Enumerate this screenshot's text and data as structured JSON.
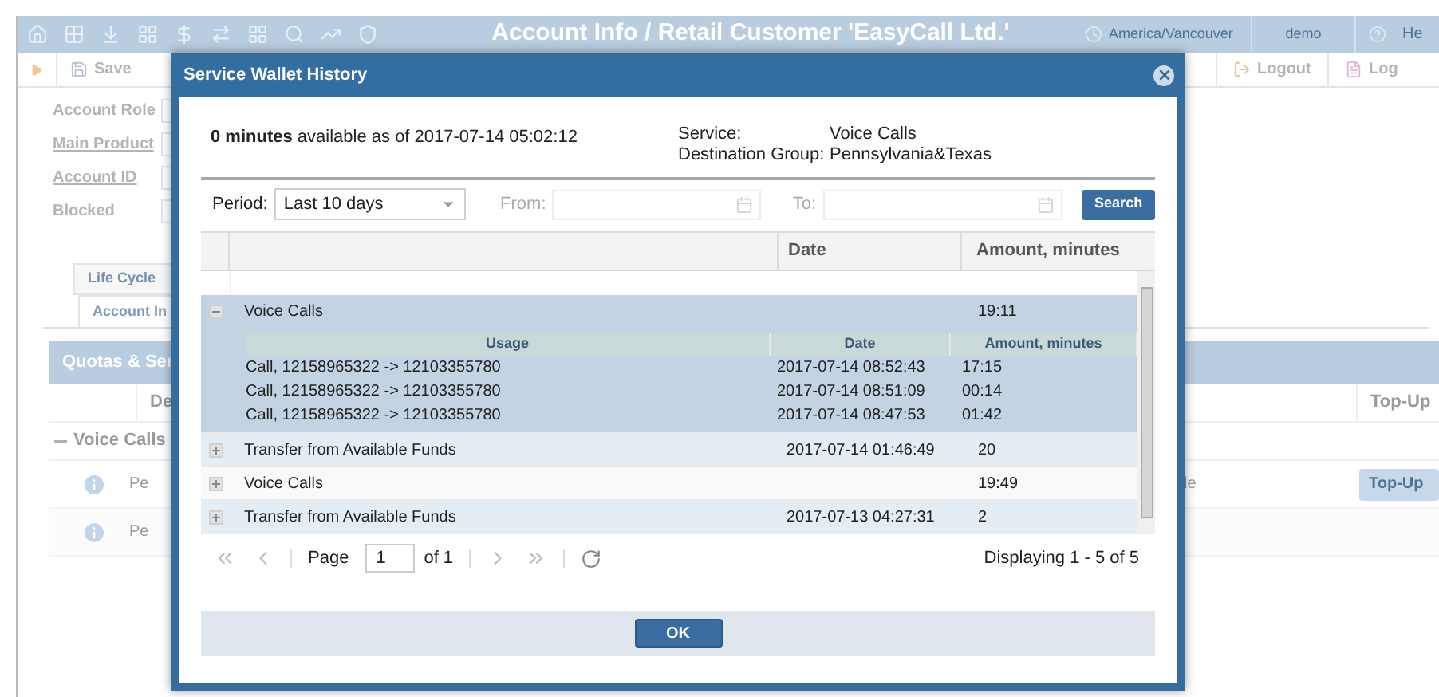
{
  "app_header": {
    "title": "Account Info / Retail Customer 'EasyCall Ltd.'",
    "timezone": "America/Vancouver",
    "user": "demo",
    "help": "He"
  },
  "toolbar": {
    "left": [
      {
        "kind": "save",
        "label": "Save"
      }
    ],
    "right": [
      {
        "kind": "logout",
        "label": "Logout"
      },
      {
        "kind": "log",
        "label": "Log"
      }
    ]
  },
  "form": {
    "fields": [
      {
        "label": "Account Role",
        "link": false
      },
      {
        "label": "Main Product",
        "link": true
      },
      {
        "label": "Account ID",
        "link": true
      },
      {
        "label": "Blocked",
        "link": false
      }
    ]
  },
  "tabs": [
    {
      "label": "Life Cycle",
      "selected": false
    },
    {
      "label": "Account In",
      "selected": true
    }
  ],
  "quotas_panel": {
    "title": "Quotas & Ser",
    "columns": [
      "De",
      "Top-Up"
    ],
    "group": {
      "label": "Voice Calls",
      "expanded": true
    },
    "rows": [
      {
        "text": "Pe",
        "column_3": "le",
        "action": "Top-Up"
      },
      {
        "text": "Pe"
      }
    ]
  },
  "dialog": {
    "title": "Service Wallet History",
    "summary": "**0 minutes** available as of 2017-07-14 05:02:12",
    "service": [
      {
        "label": "Service:",
        "value": "Voice Calls"
      },
      {
        "label": "Destination Group:",
        "value": "Pennsylvania&Texas"
      }
    ],
    "filters": {
      "period_label": "Period:",
      "period": "Last 10 days",
      "from_label": "From:",
      "to_label": "To:",
      "search": "Search"
    },
    "grid": {
      "columns": [
        "Date",
        "Amount, minutes"
      ],
      "rows": [
        {
          "label": "Voice Calls",
          "amount": "19:11",
          "expanded": true,
          "selected": true,
          "details": {
            "columns": [
              "Usage",
              "Date",
              "Amount, minutes"
            ],
            "rows": [
              [
                "Call, 12158965322 -> 12103355780",
                "2017-07-14 08:52:43",
                "17:15"
              ],
              [
                "Call, 12158965322 -> 12103355780",
                "2017-07-14 08:51:09",
                "00:14"
              ],
              [
                "Call, 12158965322 -> 12103355780",
                "2017-07-14 08:47:53",
                "01:42"
              ]
            ]
          }
        },
        {
          "label": "Transfer from Available Funds",
          "date": "2017-07-14 01:46:49",
          "amount": "20",
          "expanded": false,
          "selected": false
        },
        {
          "label": "Voice Calls",
          "amount": "19:49",
          "expanded": false,
          "selected": false
        },
        {
          "label": "Transfer from Available Funds",
          "date": "2017-07-13 04:27:31",
          "amount": "2",
          "expanded": false,
          "selected": false
        }
      ]
    },
    "pager": {
      "page_label": "Page",
      "page": "1",
      "of": "of 1",
      "status": "Displaying 1 - 5 of 5"
    },
    "ok": "OK"
  }
}
